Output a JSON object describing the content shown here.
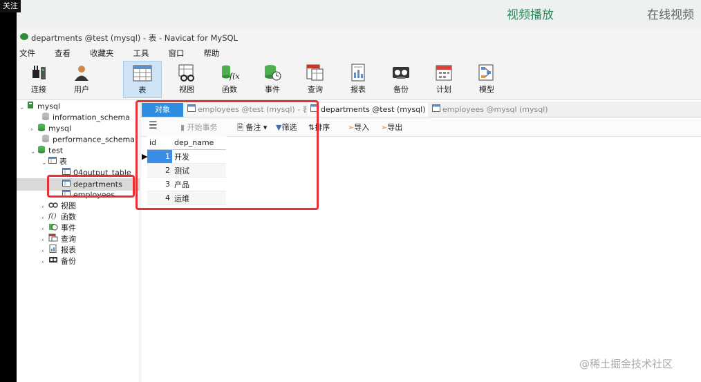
{
  "overlay": {
    "badge": "关注",
    "video_label": "视频播放",
    "online_label": "在线视频"
  },
  "window": {
    "title": "departments @test (mysql) - 表 - Navicat for MySQL"
  },
  "menu": [
    "文件",
    "查看",
    "收藏夹",
    "工具",
    "窗口",
    "帮助"
  ],
  "toolbar": [
    {
      "label": "连接",
      "icon": "connection-plug-icon"
    },
    {
      "label": "用户",
      "icon": "user-icon"
    },
    {
      "label": "表",
      "icon": "table-icon",
      "active": true
    },
    {
      "label": "视图",
      "icon": "view-icon"
    },
    {
      "label": "函数",
      "icon": "function-icon"
    },
    {
      "label": "事件",
      "icon": "event-icon"
    },
    {
      "label": "查询",
      "icon": "query-icon"
    },
    {
      "label": "报表",
      "icon": "report-icon"
    },
    {
      "label": "备份",
      "icon": "backup-icon"
    },
    {
      "label": "计划",
      "icon": "schedule-icon"
    },
    {
      "label": "模型",
      "icon": "model-icon"
    }
  ],
  "tree": {
    "connection": "mysql",
    "databases": {
      "information_schema": "information_schema",
      "mysql": "mysql",
      "performance_schema": "performance_schema",
      "test": "test"
    },
    "tables_folder": "表",
    "tables": [
      "04output_table",
      "departments",
      "employees"
    ],
    "selected_table": "departments",
    "folders": [
      "视图",
      "函数",
      "事件",
      "查询",
      "报表",
      "备份"
    ]
  },
  "tabs": {
    "objects": "对象",
    "tab1": "employees @test (mysql) - 表",
    "tab2": "departments @test (mysql) ...",
    "tab3": "employees @mysql (mysql) ..."
  },
  "subtoolbar": {
    "begin_transaction": "开始事务",
    "memo": "备注",
    "filter": "筛选",
    "sort": "排序",
    "import": "导入",
    "export": "导出"
  },
  "grid": {
    "columns": [
      "id",
      "dep_name"
    ],
    "rows": [
      {
        "id": "1",
        "dep_name": "开发"
      },
      {
        "id": "2",
        "dep_name": "测试"
      },
      {
        "id": "3",
        "dep_name": "产品"
      },
      {
        "id": "4",
        "dep_name": "运维"
      }
    ]
  },
  "watermark": "@稀土掘金技术社区",
  "colors": {
    "accent": "#2f8ee0",
    "highlight_box": "#e82f33",
    "toolbar_active": "#cfe3f6"
  }
}
